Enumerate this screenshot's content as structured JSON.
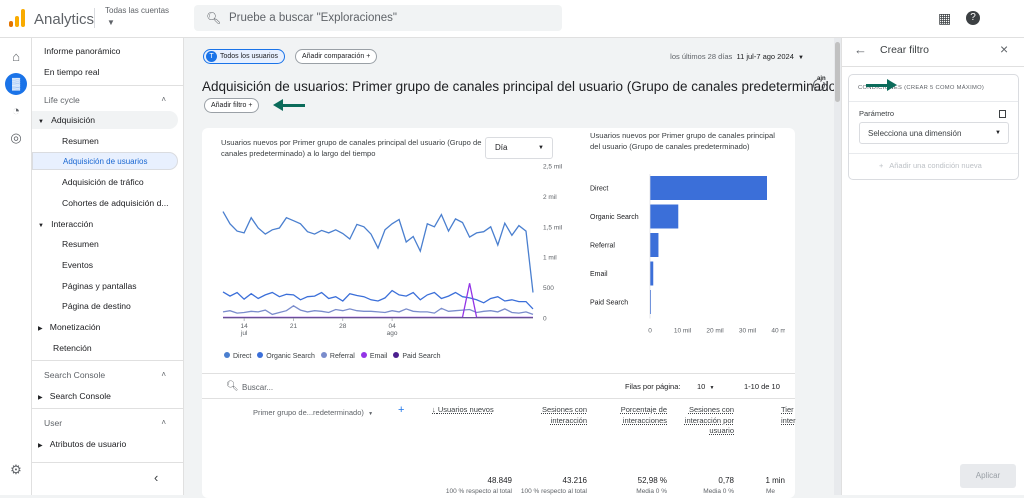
{
  "header": {
    "app_title": "Analytics",
    "account_label": "Todas las cuentas",
    "search_placeholder": "Pruebe a buscar \"Exploraciones\""
  },
  "nav": {
    "informe": "Informe panorámico",
    "tiempo_real": "En tiempo real",
    "life_cycle": "Life cycle",
    "adquisicion": "Adquisición",
    "resumen": "Resumen",
    "adq_usuarios": "Adquisición de usuarios",
    "adq_trafico": "Adquisición de tráfico",
    "cohortes": "Cohortes de adquisición d...",
    "interaccion": "Interacción",
    "resumen2": "Resumen",
    "eventos": "Eventos",
    "paginas": "Páginas y pantallas",
    "pagina_destino": "Página de destino",
    "monetizacion": "Monetización",
    "retencion": "Retención",
    "search_console_sec": "Search Console",
    "search_console": "Search Console",
    "user_sec": "User",
    "atributos": "Atributos de usuario"
  },
  "toolbar": {
    "todos": "Todos los usuarios",
    "todos_initial": "T",
    "add_comparison": "Añadir comparación",
    "date_prefix": "los últimos 28 días",
    "date_range": "11 jul-7 ago 2024"
  },
  "page": {
    "title": "Adquisición de usuarios: Primer grupo de canales principal del usuario (Grupo de canales predeterminado)",
    "add_filter": "Añadir filtro"
  },
  "line_chart": {
    "title": "Usuarios nuevos por Primer grupo de canales principal del usuario (Grupo de canales predeterminado) a lo largo del tiempo",
    "select": "Día"
  },
  "bar_chart": {
    "title": "Usuarios nuevos por Primer grupo de canales principal del usuario (Grupo de canales predeterminado)"
  },
  "chart_data": [
    {
      "type": "line",
      "x_ticks": [
        {
          "v": "14",
          "sub": "jul"
        },
        {
          "v": "21",
          "sub": ""
        },
        {
          "v": "28",
          "sub": ""
        },
        {
          "v": "04",
          "sub": "ago"
        }
      ],
      "y_ticks": [
        "2,5 mil",
        "2 mil",
        "1,5 mil",
        "1 mil",
        "500",
        "0"
      ],
      "ylim": [
        0,
        2500
      ],
      "series": [
        {
          "name": "Direct",
          "color": "#4a7fcf",
          "values": [
            1750,
            1550,
            1430,
            1400,
            1650,
            1480,
            1380,
            1450,
            1480,
            1650,
            1600,
            1550,
            1420,
            1380,
            1440,
            1400,
            1450,
            1390,
            1300,
            1540,
            1500,
            1380,
            1150,
            1450,
            1550,
            1620,
            1250,
            1340,
            1100,
            1550,
            1500,
            1700,
            1430,
            1630,
            1570,
            1330,
            1400,
            1420,
            1500,
            1200,
            1560,
            1360,
            1520,
            1430,
            420
          ]
        },
        {
          "name": "Organic Search",
          "color": "#3b6fd9",
          "values": [
            430,
            360,
            420,
            310,
            400,
            320,
            380,
            420,
            350,
            390,
            380,
            300,
            350,
            360,
            420,
            320,
            350,
            280,
            400,
            370,
            350,
            300,
            280,
            330,
            450,
            380,
            360,
            420,
            300,
            380,
            420,
            320,
            360,
            420,
            350,
            330,
            300,
            250,
            320,
            350,
            280,
            300,
            270,
            270,
            150
          ]
        },
        {
          "name": "Referral",
          "color": "#7a8ccc",
          "values": [
            100,
            120,
            80,
            90,
            110,
            100,
            130,
            60,
            90,
            120,
            200,
            130,
            100,
            120,
            110,
            90,
            140,
            120,
            150,
            120,
            110,
            110,
            100,
            90,
            120,
            100,
            150,
            110,
            100,
            100,
            80,
            160,
            110,
            120,
            130,
            140,
            90,
            110,
            120,
            100,
            150,
            90,
            80,
            100,
            60
          ]
        },
        {
          "name": "Email",
          "color": "#9334e6",
          "values": [
            10,
            10,
            10,
            10,
            10,
            10,
            10,
            10,
            10,
            10,
            10,
            10,
            10,
            10,
            10,
            10,
            10,
            10,
            10,
            10,
            10,
            10,
            10,
            10,
            10,
            10,
            10,
            10,
            10,
            10,
            10,
            10,
            10,
            10,
            10,
            570,
            10,
            10,
            10,
            10,
            10,
            10,
            10,
            10,
            10
          ]
        },
        {
          "name": "Paid Search",
          "color": "#4b1f8e",
          "values": [
            5,
            5,
            5,
            5,
            5,
            5,
            5,
            5,
            5,
            5,
            5,
            5,
            5,
            5,
            5,
            5,
            5,
            5,
            5,
            5,
            5,
            5,
            5,
            5,
            5,
            5,
            5,
            5,
            5,
            5,
            5,
            5,
            5,
            5,
            5,
            5,
            5,
            5,
            5,
            5,
            5,
            5,
            5,
            5,
            5
          ]
        }
      ]
    },
    {
      "type": "bar",
      "categories": [
        "Direct",
        "Organic Search",
        "Referral",
        "Email",
        "Paid Search"
      ],
      "values": [
        36000,
        8700,
        2600,
        1000,
        200
      ],
      "x_ticks": [
        "0",
        "10 mil",
        "20 mil",
        "30 mil",
        "40 mil"
      ],
      "xlim": [
        0,
        40000
      ],
      "color": "#3b6fd9"
    }
  ],
  "table": {
    "search_placeholder": "Buscar...",
    "rows_label": "Filas por página:",
    "rows_value": "10",
    "range": "1-10 de 10",
    "dimension": "Primer grupo de...redeterminado)",
    "cols": [
      {
        "label": "Usuarios nuevos",
        "total": "48.849",
        "sub": "100 % respecto al total"
      },
      {
        "label": "Sesiones con interacción",
        "total": "43.216",
        "sub": "100 % respecto al total"
      },
      {
        "label": "Porcentaje de interacciones",
        "total": "52,98 %",
        "sub": "Media 0 %"
      },
      {
        "label": "Sesiones con interacción por usuario",
        "total": "0,78",
        "sub": "Media 0 %"
      },
      {
        "label": "Tier inter",
        "total": "1 min",
        "sub": "Me"
      }
    ]
  },
  "panel": {
    "title": "Crear filtro",
    "conditions": "CONDICIONES (CREAR 5 COMO MÁXIMO)",
    "param": "Parámetro",
    "select_dim": "Selecciona una dimensión",
    "add_condition": "Añadir una condición nueva",
    "apply": "Aplicar"
  }
}
